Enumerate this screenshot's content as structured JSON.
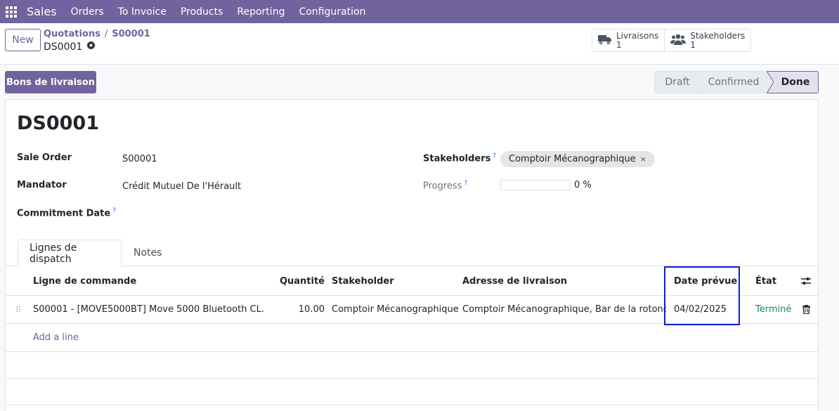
{
  "navbar": {
    "app_name": "Sales",
    "menu": [
      "Orders",
      "To Invoice",
      "Products",
      "Reporting",
      "Configuration"
    ]
  },
  "control": {
    "new_label": "New",
    "breadcrumb": [
      "Quotations",
      "S00001"
    ],
    "record_name": "DS0001",
    "smart_buttons": [
      {
        "title": "Livraisons",
        "value": "1",
        "icon": "truck-icon"
      },
      {
        "title": "Stakeholders",
        "value": "1",
        "icon": "users-icon"
      }
    ]
  },
  "header": {
    "primary_button": "Bons de livraison",
    "stages": [
      "Draft",
      "Confirmed",
      "Done"
    ],
    "current_stage": "Done"
  },
  "form": {
    "title": "DS0001",
    "sale_order_label": "Sale Order",
    "sale_order_value": "S00001",
    "mandator_label": "Mandator",
    "mandator_value": "Crédit Mutuel De l'Hérault",
    "commitment_label": "Commitment Date",
    "help_mark": "?",
    "stakeholders_label": "Stakeholders",
    "stakeholder_tag": "Comptoir Mécanographique",
    "tag_remove": "×",
    "progress_label": "Progress",
    "progress_value": 0,
    "progress_text": "0 %"
  },
  "tabs": [
    "Lignes de dispatch",
    "Notes"
  ],
  "table": {
    "columns": {
      "line": "Ligne de commande",
      "qty": "Quantité",
      "stakeholder": "Stakeholder",
      "address": "Adresse de livraison",
      "date": "Date prévue",
      "state": "État"
    },
    "rows": [
      {
        "line": "S00001 - [MOVE5000BT] Move 5000 Bluetooth CL...",
        "qty": "10.00",
        "stakeholder": "Comptoir Mécanographique",
        "address": "Comptoir Mécanographique, Bar de la rotonde",
        "date": "04/02/2025",
        "state": "Terminé"
      }
    ],
    "add_line": "Add a line"
  },
  "colors": {
    "brand": "#71639e",
    "success": "#198754",
    "highlight": "#0b1fd6"
  }
}
